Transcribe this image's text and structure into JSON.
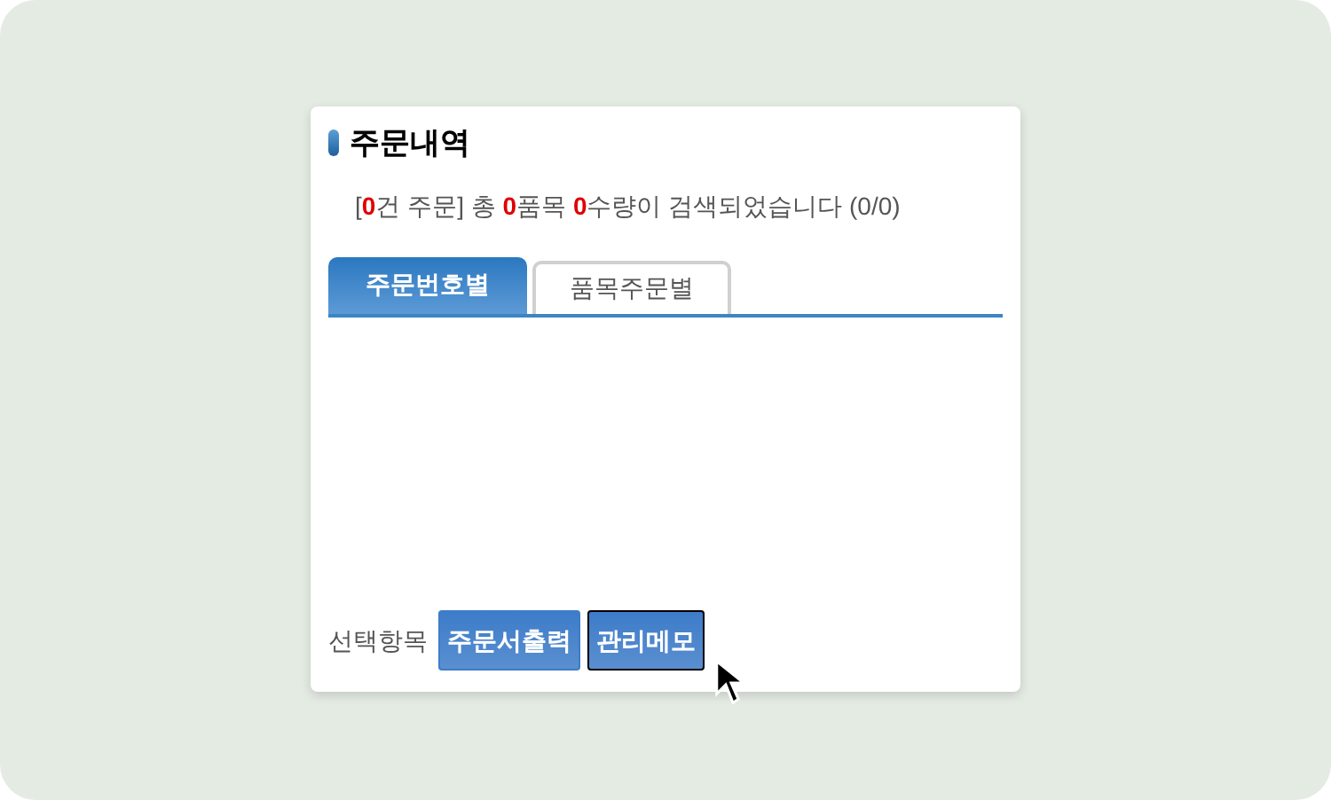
{
  "title": "주문내역",
  "summary": {
    "prefix": "[",
    "order_count": "0",
    "order_text": "건 주문] 총 ",
    "item_count": "0",
    "item_text": "품목 ",
    "quantity_count": "0",
    "quantity_text": "수량이 검색되었습니다 (0/0)"
  },
  "tabs": [
    {
      "label": "주문번호별",
      "selected": true
    },
    {
      "label": "품목주문별",
      "selected": false
    }
  ],
  "actions": {
    "label": "선택항목",
    "buttons": [
      {
        "label": "주문서출력",
        "focused": false
      },
      {
        "label": "관리메모",
        "focused": true
      }
    ]
  }
}
